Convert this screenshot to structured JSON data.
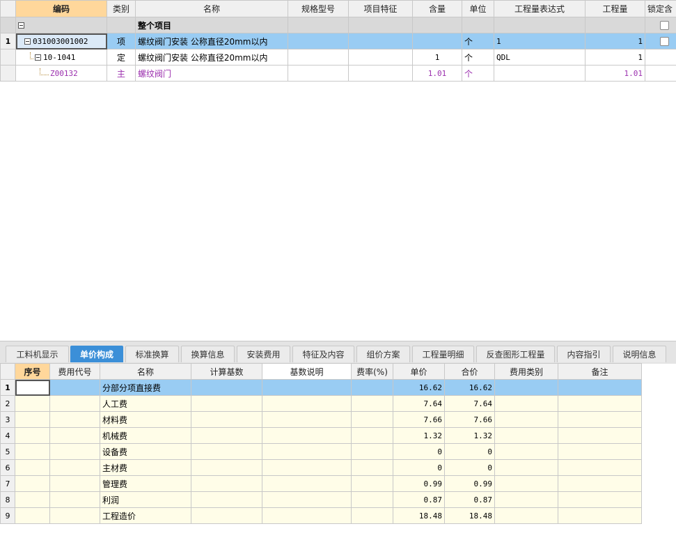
{
  "top_grid": {
    "columns": [
      "编码",
      "类别",
      "名称",
      "规格型号",
      "项目特征",
      "含量",
      "单位",
      "工程量表达式",
      "工程量",
      "锁定含"
    ],
    "group_row": {
      "name": "整个项目"
    },
    "rows": [
      {
        "num": "1",
        "code": "031003001002",
        "type": "项",
        "name": "螺纹阀门安装 公称直径20mm以内",
        "spec": "",
        "feature": "",
        "content": "",
        "unit": "个",
        "expr": "1",
        "qty": "1"
      },
      {
        "num": "",
        "code": "10-1041",
        "type": "定",
        "name": "螺纹阀门安装 公称直径20mm以内",
        "spec": "",
        "feature": "",
        "content": "1",
        "unit": "个",
        "expr": "QDL",
        "qty": "1"
      },
      {
        "num": "",
        "code": "Z00132",
        "type": "主",
        "name": "螺纹阀门",
        "spec": "",
        "feature": "",
        "content": "1.01",
        "unit": "个",
        "expr": "",
        "qty": "1.01"
      }
    ]
  },
  "tabs": [
    "工料机显示",
    "单价构成",
    "标准换算",
    "换算信息",
    "安装费用",
    "特征及内容",
    "组价方案",
    "工程量明细",
    "反查图形工程量",
    "内容指引",
    "说明信息"
  ],
  "active_tab": "单价构成",
  "bottom_grid": {
    "columns": [
      "序号",
      "费用代号",
      "名称",
      "计算基数",
      "基数说明",
      "费率(%)",
      "单价",
      "合价",
      "费用类别",
      "备注"
    ],
    "rows": [
      {
        "num": "1",
        "name": "分部分项直接费",
        "unit_price": "16.62",
        "total": "16.62"
      },
      {
        "num": "2",
        "name": "人工费",
        "unit_price": "7.64",
        "total": "7.64"
      },
      {
        "num": "3",
        "name": "材料费",
        "unit_price": "7.66",
        "total": "7.66"
      },
      {
        "num": "4",
        "name": "机械费",
        "unit_price": "1.32",
        "total": "1.32"
      },
      {
        "num": "5",
        "name": "设备费",
        "unit_price": "0",
        "total": "0"
      },
      {
        "num": "6",
        "name": "主材费",
        "unit_price": "0",
        "total": "0"
      },
      {
        "num": "7",
        "name": "管理费",
        "unit_price": "0.99",
        "total": "0.99"
      },
      {
        "num": "8",
        "name": "利润",
        "unit_price": "0.87",
        "total": "0.87"
      },
      {
        "num": "9",
        "name": "工程造价",
        "unit_price": "18.48",
        "total": "18.48"
      }
    ]
  },
  "colors": {
    "selection": "#99ccf3",
    "active_tab": "#3b8fd8",
    "main_material": "#9b2fae",
    "sorted_header": "#ffd79b",
    "cell_bg": "#fffde8"
  },
  "icons": {
    "expander": "collapse-minus-icon",
    "lock": "checkbox-icon"
  }
}
